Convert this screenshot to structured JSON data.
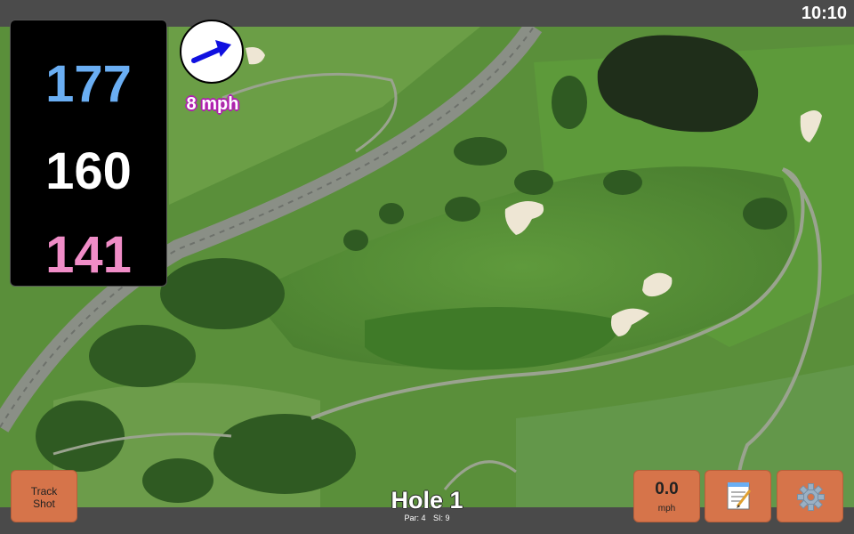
{
  "status_bar": {
    "time": "10:10"
  },
  "distances": {
    "back": "177",
    "middle": "160",
    "front": "141"
  },
  "wind": {
    "speed": "8 mph",
    "direction_icon": "arrow-right-up-icon",
    "arrow_color": "#1010e0"
  },
  "hole": {
    "title": "Hole 1",
    "par": "Par: 4",
    "stroke_index": "SI: 9"
  },
  "buttons": {
    "track_shot": {
      "line1": "Track",
      "line2": "Shot"
    },
    "speed": {
      "value": "0.0",
      "unit": "mph"
    },
    "notes": {
      "icon": "notepad-icon",
      "glyph": "📝"
    },
    "settings": {
      "icon": "gear-icon",
      "glyph": "⚙"
    }
  },
  "colors": {
    "back_distance": "#6aaef3",
    "middle_distance": "#ffffff",
    "front_distance": "#f08dc7",
    "button_bg": "#d6744a",
    "wind_outline": "#b020b0"
  }
}
